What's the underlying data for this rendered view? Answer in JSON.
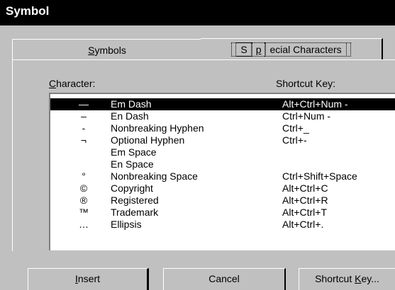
{
  "window": {
    "title": "Symbol"
  },
  "tabs": [
    {
      "label": "Symbols",
      "mnemonic": "S",
      "rest": "ymbols",
      "active": false
    },
    {
      "label": "Special Characters",
      "pre": "S",
      "mnemonic": "p",
      "rest": "ecial Characters",
      "active": true
    }
  ],
  "list": {
    "column_character": {
      "mnemonic": "C",
      "rest": "haracter:"
    },
    "column_shortcut": "Shortcut Key:",
    "rows": [
      {
        "symbol": "—",
        "name": "Em Dash",
        "shortcut": "Alt+Ctrl+Num -",
        "selected": true
      },
      {
        "symbol": "–",
        "name": "En Dash",
        "shortcut": "Ctrl+Num -"
      },
      {
        "symbol": "-",
        "name": "Nonbreaking Hyphen",
        "shortcut": "Ctrl+_"
      },
      {
        "symbol": "¬",
        "name": "Optional Hyphen",
        "shortcut": "Ctrl+-"
      },
      {
        "symbol": "",
        "name": "Em Space",
        "shortcut": ""
      },
      {
        "symbol": "",
        "name": "En Space",
        "shortcut": ""
      },
      {
        "symbol": "°",
        "name": "Nonbreaking Space",
        "shortcut": "Ctrl+Shift+Space"
      },
      {
        "symbol": "©",
        "name": "Copyright",
        "shortcut": "Alt+Ctrl+C"
      },
      {
        "symbol": "®",
        "name": "Registered",
        "shortcut": "Alt+Ctrl+R"
      },
      {
        "symbol": "™",
        "name": "Trademark",
        "shortcut": "Alt+Ctrl+T"
      },
      {
        "symbol": "…",
        "name": "Ellipsis",
        "shortcut": "Alt+Ctrl+."
      }
    ]
  },
  "buttons": {
    "insert": {
      "mnemonic": "I",
      "rest": "nsert"
    },
    "cancel": "Cancel",
    "shortcut_key": {
      "pre": "Shortcut ",
      "mnemonic": "K",
      "rest": "ey..."
    }
  }
}
